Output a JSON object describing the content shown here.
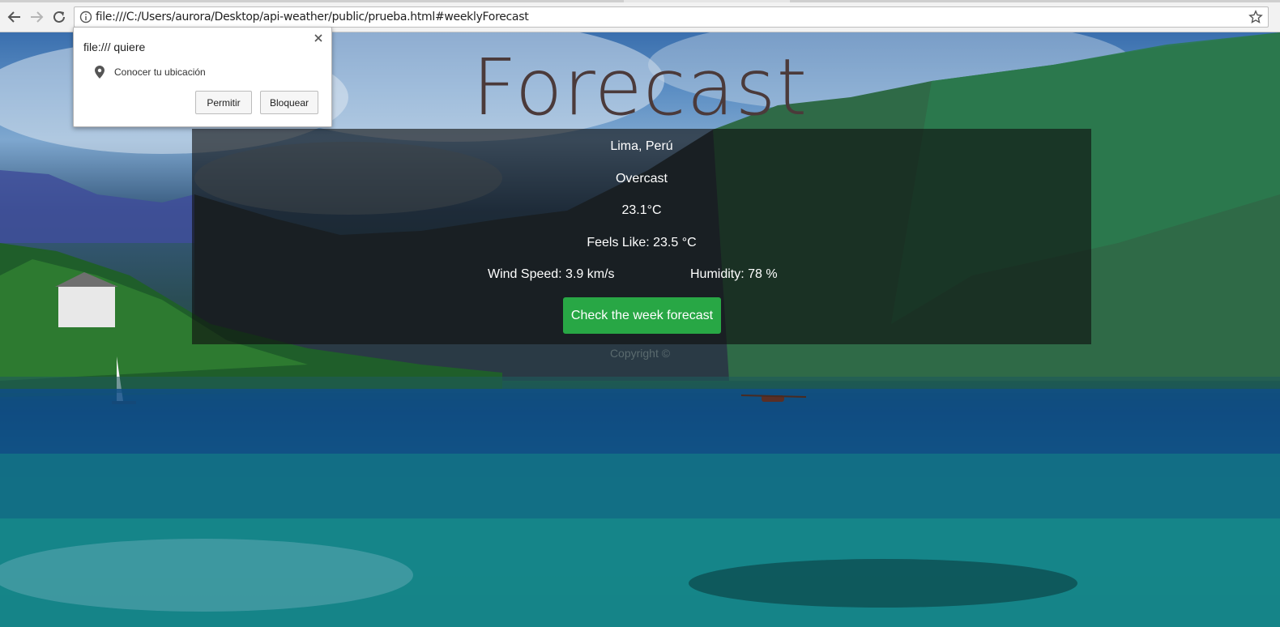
{
  "browser": {
    "url": "file:///C:/Users/aurora/Desktop/api-weather/public/prueba.html#weeklyForecast",
    "icons": [
      "back-arrow-icon",
      "forward-arrow-icon",
      "reload-icon",
      "info-icon",
      "star-icon"
    ]
  },
  "permission_popup": {
    "origin": "file:/// quiere",
    "permission": "Conocer tu ubicación",
    "allow_label": "Permitir",
    "block_label": "Bloquear",
    "icons": [
      "close-icon",
      "location-pin-icon"
    ]
  },
  "page": {
    "title": "Forecast",
    "location": "Lima, Perú",
    "condition": "Overcast",
    "temperature": "23.1°C",
    "feels_like": "Feels Like: 23.5 °C",
    "wind_speed": "Wind Speed: 3.9 km/s",
    "humidity": "Humidity: 78 %",
    "week_button": "Check the week forecast",
    "copyright": "Copyright ©"
  },
  "colors": {
    "button_green": "#28a745",
    "title_color": "#4b3a3a",
    "card_overlay": "rgba(15,15,15,0.62)"
  }
}
